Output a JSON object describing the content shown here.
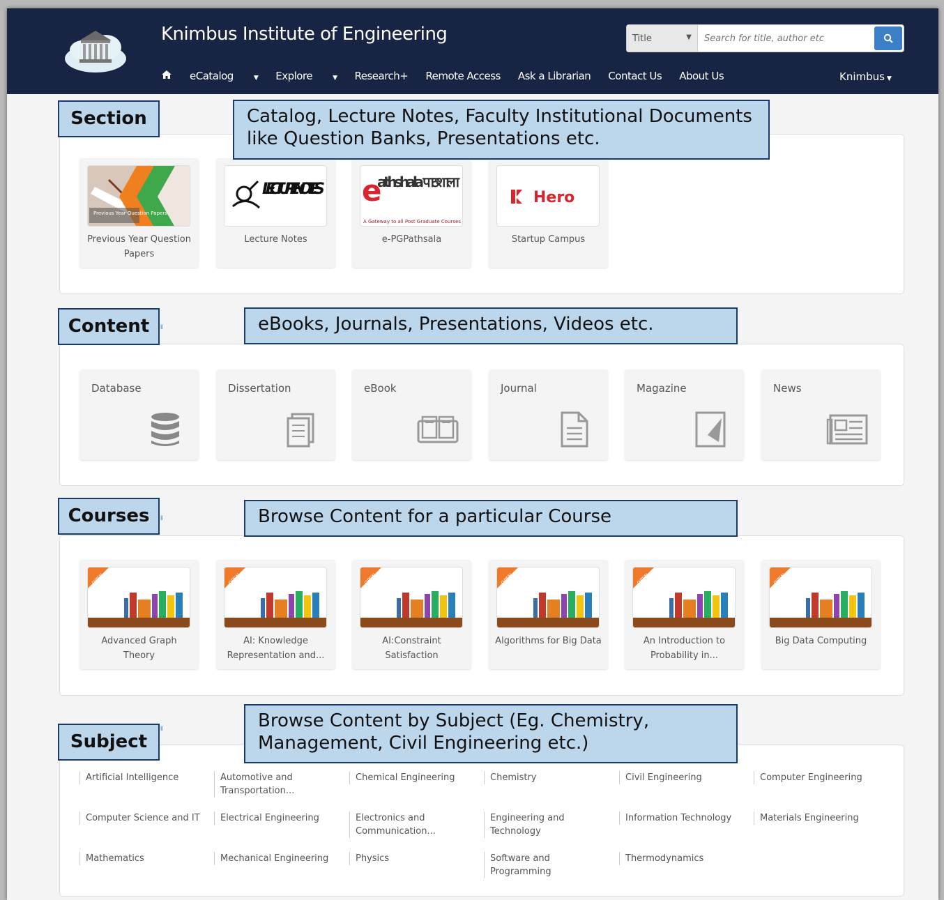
{
  "header": {
    "site_title": "Knimbus Institute of Engineering",
    "search_select": "Title",
    "search_placeholder": "Search for title, author etc",
    "nav": [
      "eCatalog",
      "Explore",
      "Research+",
      "Remote Access",
      "Ask a Librarian",
      "Contact Us",
      "About Us"
    ],
    "user_menu": "Knimbus"
  },
  "section": {
    "tag": "Section",
    "note": "Catalog, Lecture Notes, Faculty Institutional Documents like Question Banks, Presentations etc.",
    "tiles": [
      {
        "caption": "Previous Year Question Papers",
        "image_text": "Previous Year Question Papers"
      },
      {
        "caption": "Lecture Notes",
        "image_text": "LECTURE NOTES"
      },
      {
        "caption": "e-PGPathsala",
        "image_text": "athshala पाठशाला",
        "image_subtext": "A Gateway to all Post Graduate Courses"
      },
      {
        "caption": "Startup Campus",
        "image_text": "Hero"
      }
    ]
  },
  "content": {
    "tag": "Content",
    "note": "eBooks, Journals, Presentations, Videos etc.",
    "tiles": [
      "Database",
      "Dissertation",
      "eBook",
      "Journal",
      "Magazine",
      "News"
    ]
  },
  "courses": {
    "tag": "Courses",
    "note": "Browse Content for a particular Course",
    "ribbon": "OPEN",
    "tiles": [
      "Advanced Graph Theory",
      "AI: Knowledge Representation and...",
      "AI:Constraint Satisfaction",
      "Algorithms for Big Data",
      "An Introduction to Probability in...",
      "Big Data Computing"
    ]
  },
  "subject": {
    "tag": "Subject",
    "note": "Browse Content by Subject (Eg. Chemistry, Management, Civil Engineering etc.)",
    "items": [
      "Artificial Intelligence",
      "Automotive and Transportation...",
      "Chemical Engineering",
      "Chemistry",
      "Civil Engineering",
      "Computer Engineering",
      "Computer Science and IT",
      "Electrical Engineering",
      "Electronics and Communication...",
      "Engineering and Technology",
      "Information Technology",
      "Materials Engineering",
      "Mathematics",
      "Mechanical Engineering",
      "Physics",
      "Software and Programming",
      "Thermodynamics"
    ]
  },
  "colors": {
    "header_bg": "#172443",
    "search_button": "#3a7fc7",
    "annotation_fill": "#bcd6ec",
    "annotation_border": "#1b3a6b",
    "ribbon": "#f07a2b"
  }
}
